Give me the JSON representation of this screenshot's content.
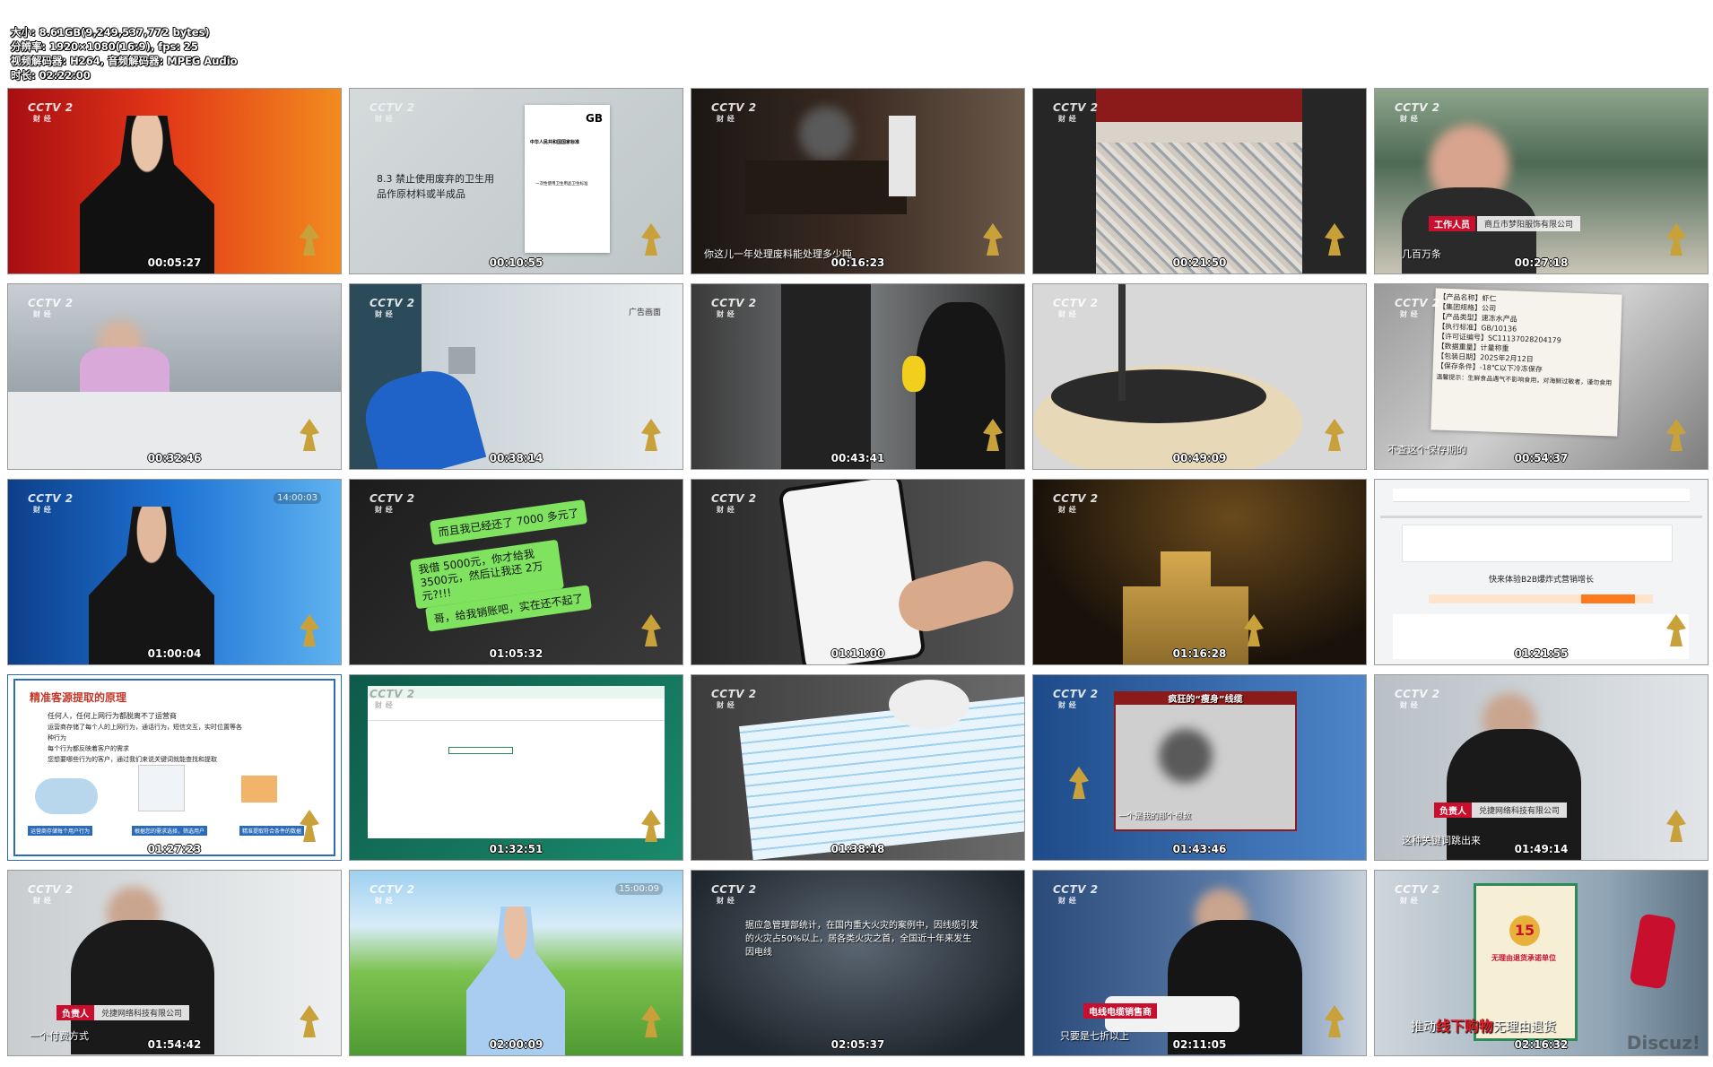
{
  "meta": {
    "size": "大小: 8.61GB(9,249,537,772 bytes)",
    "resolution": "分辨率: 1920×1080(16:9), fps: 25",
    "codec": "视频解码器: H264, 音频解码器: MPEG Audio",
    "duration": "时长: 02:22:00"
  },
  "logo": {
    "brand": "CCTV 2",
    "sub": "财 经"
  },
  "thumbnails": [
    {
      "timestamp": "00:05:27"
    },
    {
      "timestamp": "00:10:55",
      "clause": "8.3 禁止使用废弃的卫生用品作原材料或半成品",
      "doc_title": "中华人民共和国国家标准",
      "doc_mark": "GB",
      "doc_subtitle": "一次性使用卫生用品卫生标准"
    },
    {
      "timestamp": "00:16:23",
      "caption": "你这儿一年处理废料能处理多少吨"
    },
    {
      "timestamp": "00:21:50"
    },
    {
      "timestamp": "00:27:18",
      "tag_role": "工作人员",
      "tag_company": "商丘市梦阳服饰有限公司",
      "caption": "几百万条"
    },
    {
      "timestamp": "00:32:46"
    },
    {
      "timestamp": "00:38:14",
      "corner_note": "广告画面"
    },
    {
      "timestamp": "00:43:41"
    },
    {
      "timestamp": "00:49:09"
    },
    {
      "timestamp": "00:54:37",
      "label_lines": [
        "【产品名称】虾仁",
        "【集团规格】公司",
        "【产品类型】速冻水产品",
        "【执行标准】GB/10136",
        "【许可证编号】SC11137028204179",
        "【数据重量】计量称重",
        "【包装日期】2025年2月12日",
        "【保存条件】-18℃以下冷冻保存"
      ],
      "label_note": "温馨提示：生鲜食品遇气不影响食用，对海鲜过敏者，谨勿食用",
      "caption": "不查这个保存期的"
    },
    {
      "timestamp": "01:00:04",
      "clock": "14:00:03"
    },
    {
      "timestamp": "01:05:32",
      "bubbles": [
        "而且我已经还了 7000 多元了",
        "我借 5000元，你才给我 3500元，然后让我还 2万元?!!!",
        "哥，给我销账吧，实在还不起了"
      ]
    },
    {
      "timestamp": "01:11:00"
    },
    {
      "timestamp": "01:16:28"
    },
    {
      "timestamp": "01:21:55",
      "web_title": "快来体验B2B爆炸式营销增长"
    },
    {
      "timestamp": "01:27:23",
      "slide_title": "精准客源提取的原理",
      "slide_lines": [
        "任何人，任何上网行为都脱离不了运营商",
        "运营商存储了每个人的上网行为，通话行为，短信交互，实时位置等各种行为",
        "每个行为都反映着客户的需求",
        "您想要哪些行为的客户，通过我们来说关键词就能查找和提取"
      ],
      "slide_boxes": [
        "运营商存储每个用户行为",
        "根据您的需求选择，筛选用户",
        "精准提取符合条件的数据"
      ]
    },
    {
      "timestamp": "01:32:51"
    },
    {
      "timestamp": "01:38:18"
    },
    {
      "timestamp": "01:43:46",
      "banner": "疯狂的“瘦身”线缆",
      "caption": "一个是我的那个根数"
    },
    {
      "timestamp": "01:49:14",
      "tag_role": "负责人",
      "tag_company": "兑捷网络科技有限公司",
      "caption": "这种关键词跳出来"
    },
    {
      "timestamp": "01:54:42",
      "tag_role": "负责人",
      "tag_company": "兑捷网络科技有限公司",
      "caption": "一个付费方式"
    },
    {
      "timestamp": "02:00:09",
      "clock": "15:00:09"
    },
    {
      "timestamp": "02:05:37",
      "quote": "据应急管理部统计，在国内重大火灾的案例中，因线缆引发的火灾占50%以上，居各类火灾之首，全国近十年来发生因电线"
    },
    {
      "timestamp": "02:11:05",
      "tag_role": "电线电缆销售商",
      "caption": "只要是七折以上"
    },
    {
      "timestamp": "02:16:32",
      "slogan_a": "推动",
      "slogan_b": "线下购物",
      "slogan_c": "无理由退货",
      "poster_num": "15",
      "poster_text": "无理由退货承诺单位"
    }
  ],
  "watermark": "Discuz!",
  "colors": {
    "cctv_red": "#c8102e",
    "chat_green": "#7fe35f",
    "emblem_gold": "#c9a13b"
  }
}
